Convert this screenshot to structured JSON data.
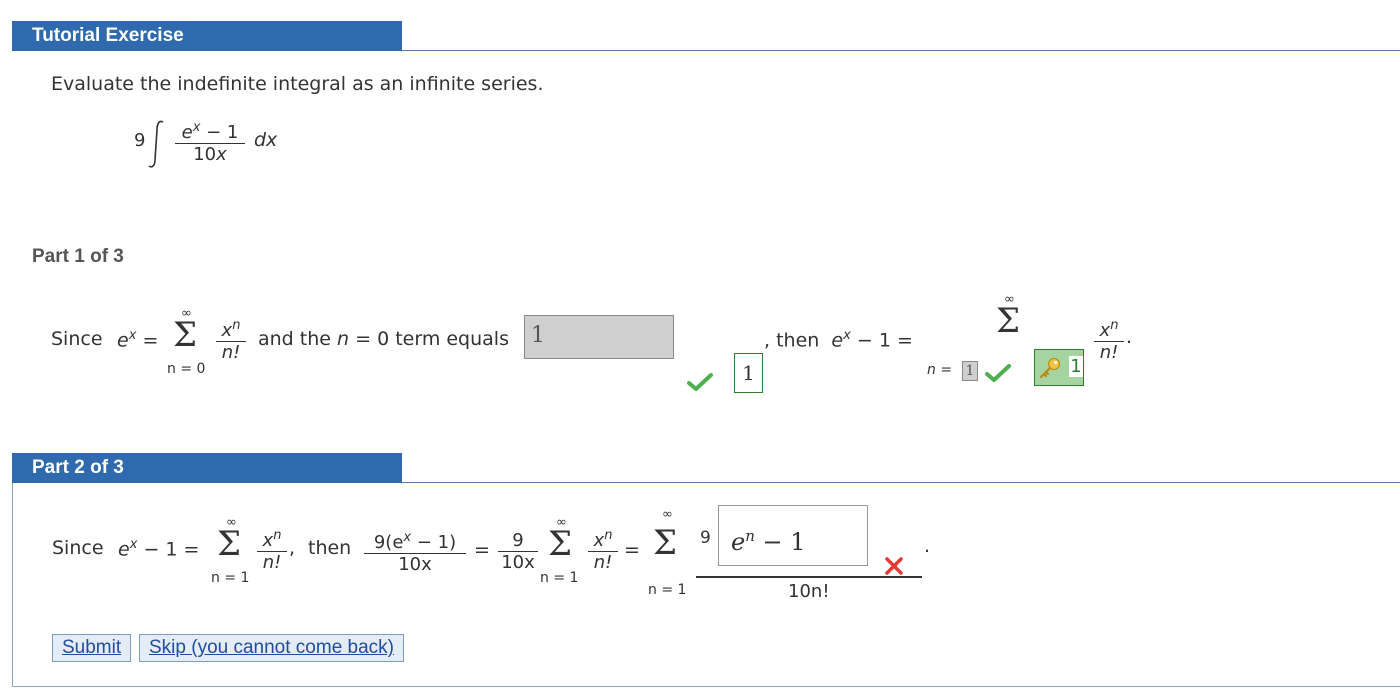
{
  "tutorial": {
    "title": "Tutorial Exercise",
    "prompt": "Evaluate the indefinite integral as an infinite series.",
    "integral": {
      "coef": "9",
      "num": "e",
      "num_exp": "x",
      "num_rest": " − 1",
      "den": "10",
      "den_var": "x",
      "dx": "dx"
    }
  },
  "part1": {
    "label": "Part 1 of 3",
    "since": "Since",
    "ex": "e",
    "ex_exp": "x",
    "eq": "=",
    "sum_top": "∞",
    "sum_bottom": "n = 0",
    "frac_num": "x",
    "frac_num_exp": "n",
    "frac_den": "n!",
    "and_text": "and the",
    "n_var": "n",
    "term_text": "= 0 term equals",
    "term_value": "1",
    "answer_value": "1",
    "then_text": ", then",
    "ex2": "e",
    "ex2_exp": "x",
    "minus_one": "− 1 =",
    "sum2_top": "∞",
    "sum2_bottom_prefix": "n =",
    "sum2_bottom_value": "1",
    "key_value": "1",
    "frac2_num": "x",
    "frac2_num_exp": "n",
    "frac2_den": "n!",
    "period": "."
  },
  "part2": {
    "label": "Part 2 of 3",
    "since": "Since",
    "ex": "e",
    "ex_exp": "x",
    "minus_one_eq": "− 1 =",
    "sum_top": "∞",
    "sum_bottom": "n = 1",
    "frac_num": "x",
    "frac_num_exp": "n",
    "frac_den": "n!",
    "comma": ",",
    "then_text": "then",
    "frac_a_num": "9(e",
    "frac_a_exp": "x",
    "frac_a_rest": " − 1)",
    "frac_a_den": "10x",
    "eq1": "=",
    "frac_b_num": "9",
    "frac_b_den": "10x",
    "sum2_top": "∞",
    "sum2_bottom": "n = 1",
    "frac_c_num": "x",
    "frac_c_exp": "n",
    "frac_c_den": "n!",
    "eq2": "=",
    "sum3_top": "∞",
    "sum3_bottom": "n = 1",
    "ans_coef": "9",
    "ans_input_base": "e",
    "ans_input_exp": "n",
    "ans_input_rest": " − 1",
    "ans_den": "10n!",
    "period": "."
  },
  "buttons": {
    "submit": "Submit",
    "skip": "Skip (you cannot come back)"
  },
  "colors": {
    "header_bg": "#2e6aad",
    "correct": "#4caf50",
    "incorrect": "#e53935",
    "button_bg": "#e3ecf7"
  }
}
